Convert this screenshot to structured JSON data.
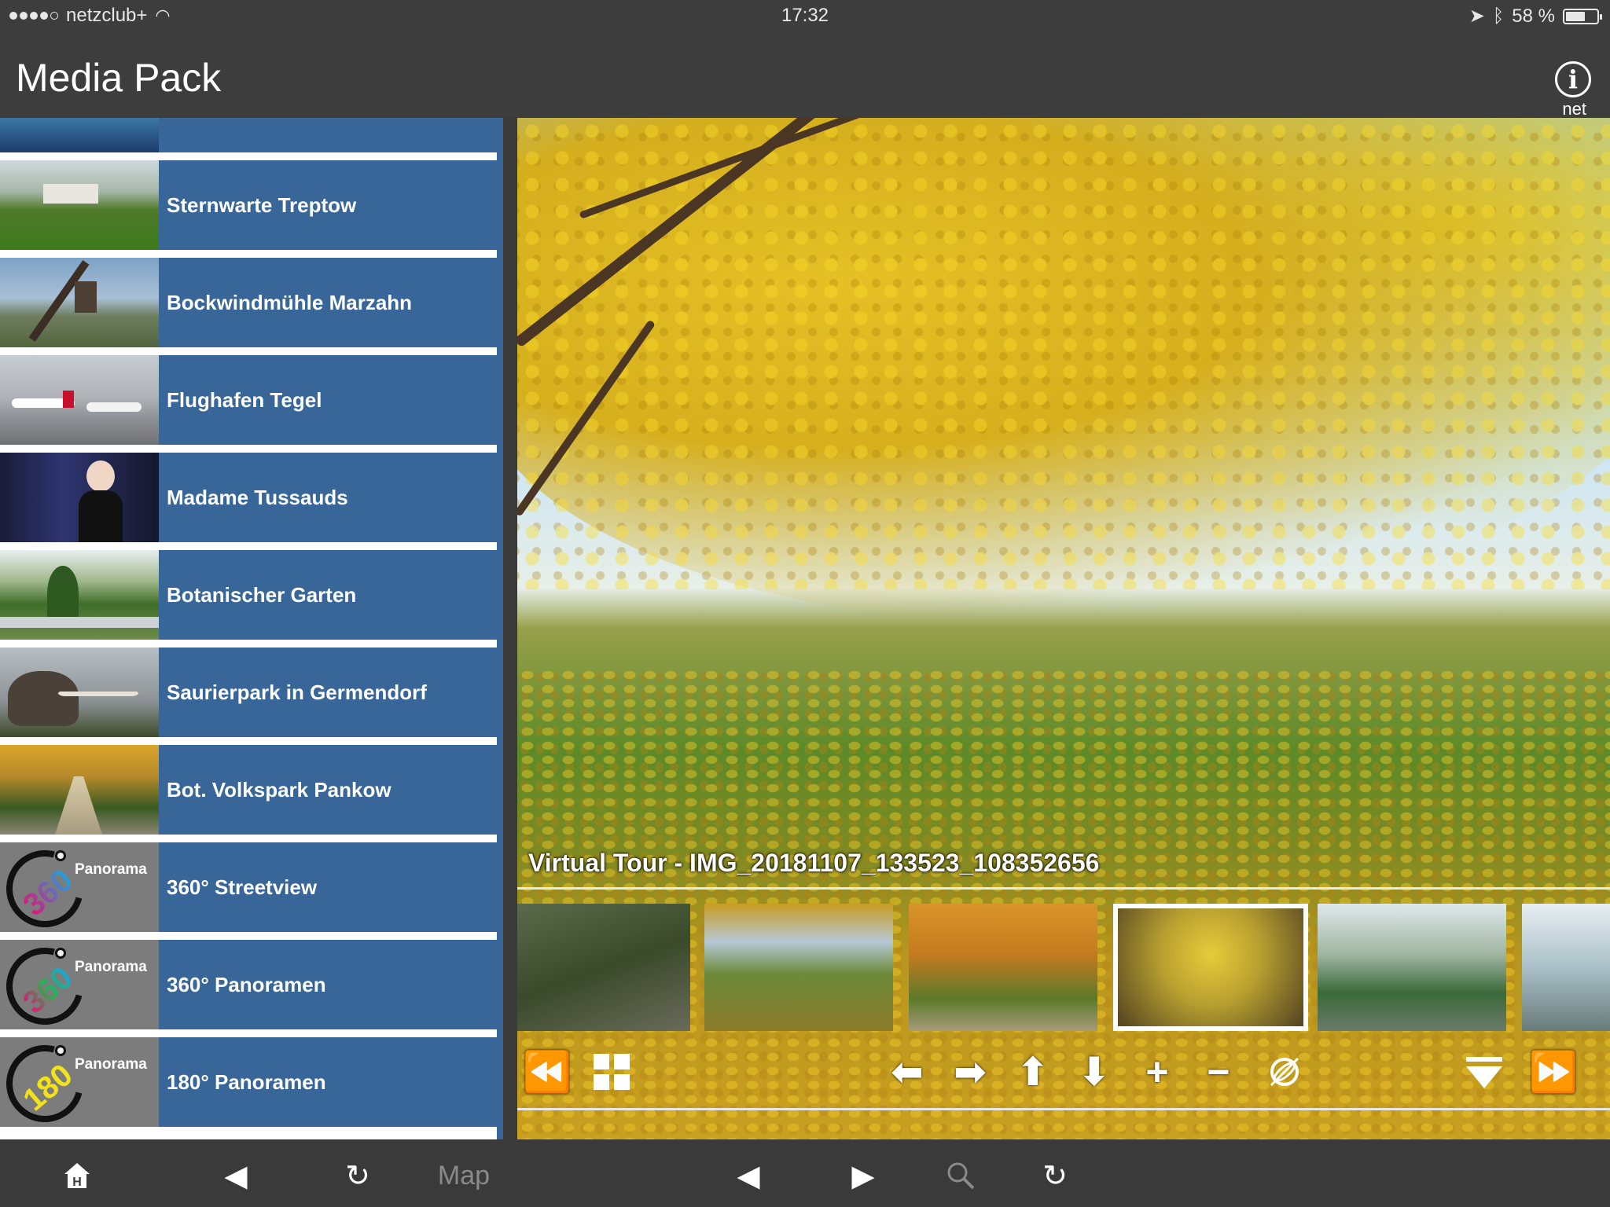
{
  "status": {
    "carrier": "netzclub+",
    "time": "17:32",
    "battery": "58 %",
    "battery_level": 0.58
  },
  "header": {
    "title": "Media Pack",
    "info_sub": "net"
  },
  "sidebar": {
    "items": [
      {
        "label": "Sternwarte Treptow"
      },
      {
        "label": "Bockwindmühle Marzahn"
      },
      {
        "label": "Flughafen Tegel"
      },
      {
        "label": "Madame Tussauds"
      },
      {
        "label": "Botanischer Garten"
      },
      {
        "label": "Saurierpark in Germendorf"
      },
      {
        "label": "Bot. Volkspark Pankow"
      },
      {
        "label": "360° Streetview",
        "badge": "360",
        "badge_word": "Panorama"
      },
      {
        "label": "360° Panoramen",
        "badge": "360",
        "badge_word": "Panorama"
      },
      {
        "label": "180° Panoramen",
        "badge": "180",
        "badge_word": "Panorama"
      }
    ]
  },
  "viewer": {
    "caption": "Virtual Tour - IMG_20181107_133523_108352656",
    "selected_thumbnail": 4
  },
  "controls": {
    "rewind_icon": "double-chevron-left-icon",
    "grid_icon": "grid-icon",
    "left_icon": "arrow-left-icon",
    "right_icon": "arrow-right-icon",
    "up_icon": "arrow-up-icon",
    "down_icon": "arrow-down-icon",
    "zoom_in_icon": "plus-icon",
    "zoom_out_icon": "minus-icon",
    "gyro_icon": "gyroscope-icon",
    "collapse_icon": "collapse-down-icon",
    "forward_icon": "double-chevron-right-icon"
  },
  "toolbar": {
    "map_label": "Map"
  }
}
